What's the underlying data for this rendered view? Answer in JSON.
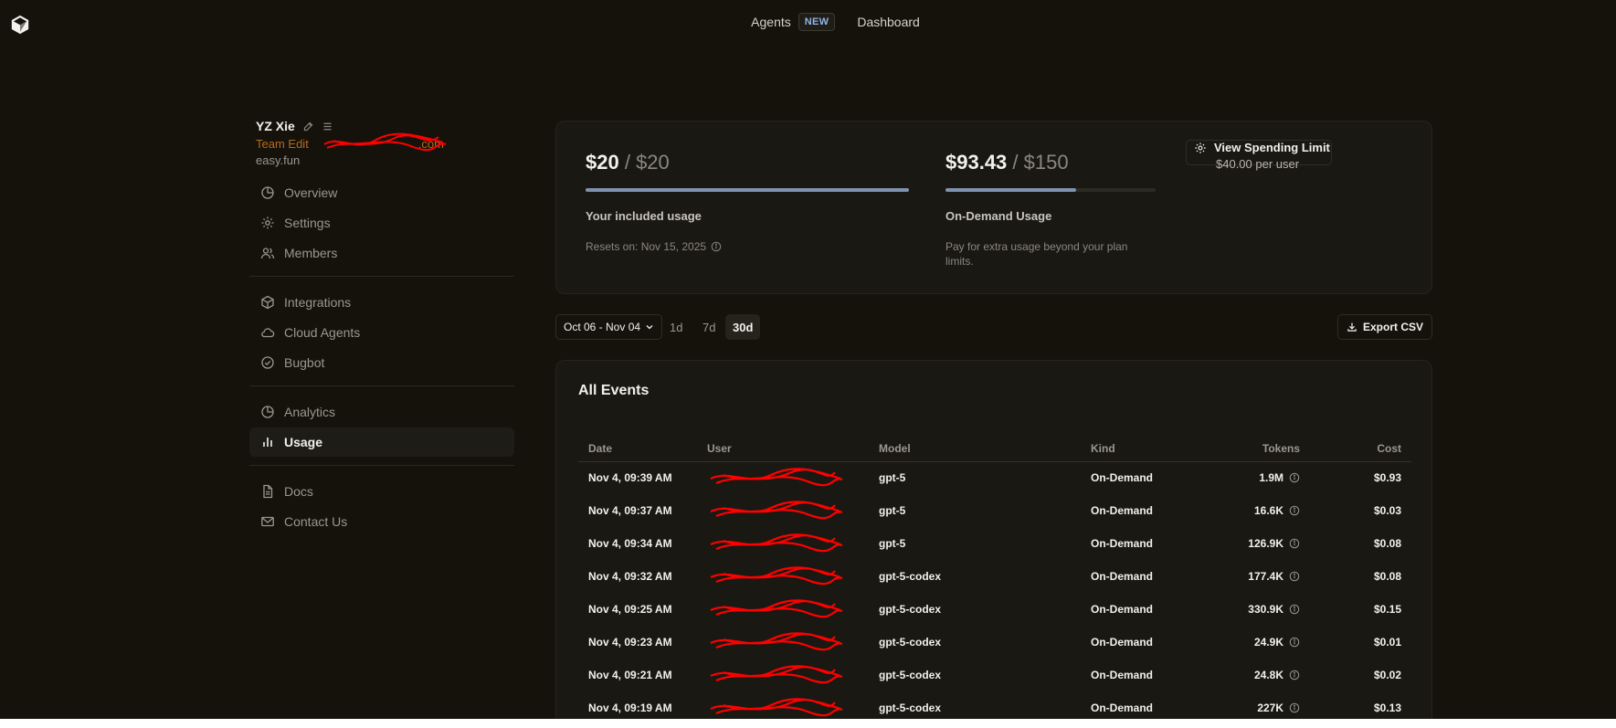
{
  "topnav": {
    "agents_label": "Agents",
    "agents_badge": "NEW",
    "dashboard_label": "Dashboard"
  },
  "profile": {
    "name": "YZ Xie",
    "email_prefix": "Team Edit",
    "email_suffix": ".com",
    "org": "easy.fun"
  },
  "sidebar": {
    "groups": [
      [
        {
          "label": "Overview",
          "icon": "pie-chart-icon"
        },
        {
          "label": "Settings",
          "icon": "gear-icon"
        },
        {
          "label": "Members",
          "icon": "users-icon"
        }
      ],
      [
        {
          "label": "Integrations",
          "icon": "cube-icon"
        },
        {
          "label": "Cloud Agents",
          "icon": "cloud-icon"
        },
        {
          "label": "Bugbot",
          "icon": "check-circle-icon"
        }
      ],
      [
        {
          "label": "Analytics",
          "icon": "pie-chart-icon"
        },
        {
          "label": "Usage",
          "icon": "bar-chart-icon",
          "active": true
        }
      ],
      [
        {
          "label": "Docs",
          "icon": "document-icon"
        },
        {
          "label": "Contact Us",
          "icon": "mail-icon"
        }
      ]
    ]
  },
  "included": {
    "used": "$20",
    "limit": "/ $20",
    "fraction": 1.0,
    "label": "Your included usage",
    "reset": "Resets on: Nov 15, 2025"
  },
  "ondemand": {
    "used": "$93.43",
    "limit": "/ $150",
    "fraction": 0.6229,
    "label": "On-Demand Usage",
    "note": "Pay for extra usage beyond your plan limits."
  },
  "spending": {
    "label": "View Spending Limit",
    "per_user": "$40.00 per user"
  },
  "filters": {
    "date_range": "Oct 06 - Nov 04",
    "ranges": [
      "1d",
      "7d",
      "30d"
    ],
    "active_range": "30d",
    "export_label": "Export CSV"
  },
  "events": {
    "title": "All Events",
    "columns": [
      "Date",
      "User",
      "Model",
      "Kind",
      "Tokens",
      "Cost"
    ],
    "rows": [
      {
        "date": "Nov 4, 09:39 AM",
        "model": "gpt-5",
        "kind": "On-Demand",
        "tokens": "1.9M",
        "cost": "$0.93"
      },
      {
        "date": "Nov 4, 09:37 AM",
        "model": "gpt-5",
        "kind": "On-Demand",
        "tokens": "16.6K",
        "cost": "$0.03"
      },
      {
        "date": "Nov 4, 09:34 AM",
        "model": "gpt-5",
        "kind": "On-Demand",
        "tokens": "126.9K",
        "cost": "$0.08"
      },
      {
        "date": "Nov 4, 09:32 AM",
        "model": "gpt-5-codex",
        "kind": "On-Demand",
        "tokens": "177.4K",
        "cost": "$0.08"
      },
      {
        "date": "Nov 4, 09:25 AM",
        "model": "gpt-5-codex",
        "kind": "On-Demand",
        "tokens": "330.9K",
        "cost": "$0.15"
      },
      {
        "date": "Nov 4, 09:23 AM",
        "model": "gpt-5-codex",
        "kind": "On-Demand",
        "tokens": "24.9K",
        "cost": "$0.01"
      },
      {
        "date": "Nov 4, 09:21 AM",
        "model": "gpt-5-codex",
        "kind": "On-Demand",
        "tokens": "24.8K",
        "cost": "$0.02"
      },
      {
        "date": "Nov 4, 09:19 AM",
        "model": "gpt-5-codex",
        "kind": "On-Demand",
        "tokens": "227K",
        "cost": "$0.13"
      }
    ]
  },
  "colors": {
    "background": "#14120b",
    "card": "#1a1812",
    "meter_fill": "#7e93b0",
    "badge": "#8fb4e8",
    "email": "#b86a1e",
    "redaction": "#ff0000"
  }
}
